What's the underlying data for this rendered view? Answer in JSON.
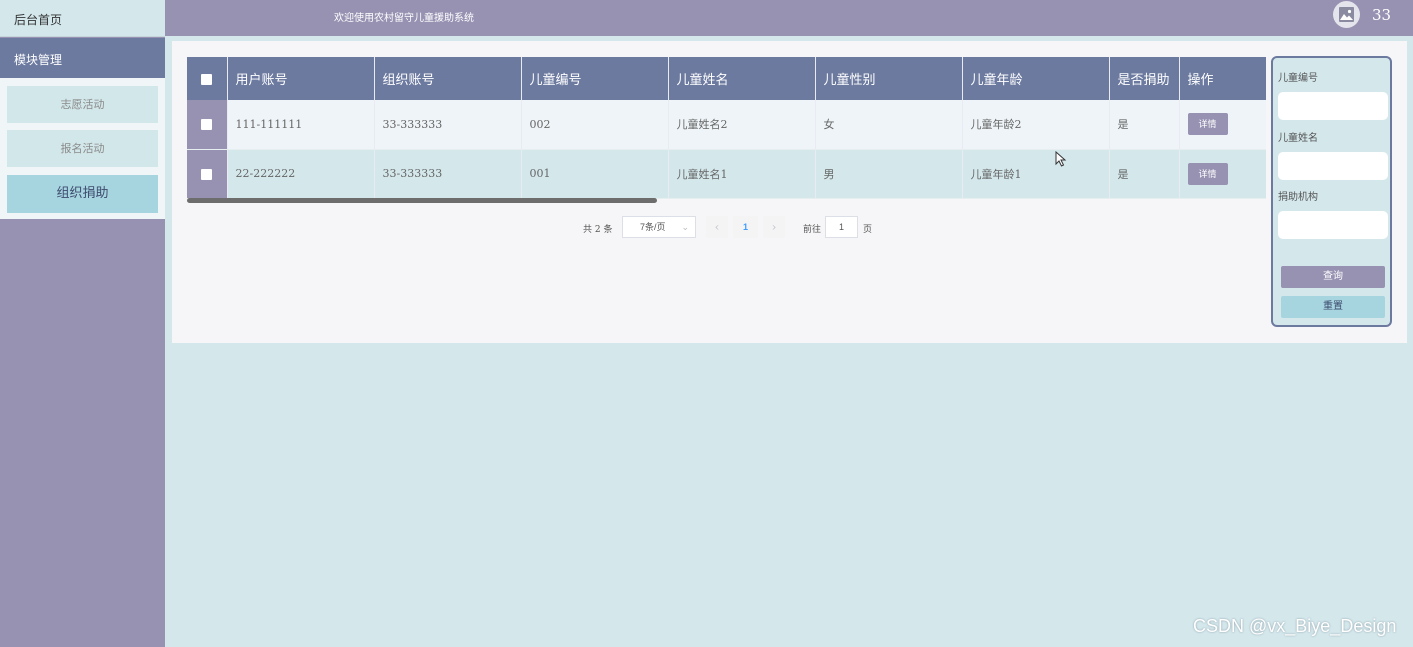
{
  "sidebar": {
    "home_label": "后台首页",
    "module_label": "模块管理",
    "items": [
      {
        "label": "志愿活动"
      },
      {
        "label": "报名活动"
      },
      {
        "label": "组织捐助"
      }
    ]
  },
  "header": {
    "welcome": "欢迎使用农村留守儿童援助系统",
    "user_number": "33"
  },
  "table": {
    "columns": [
      "用户账号",
      "组织账号",
      "儿童编号",
      "儿童姓名",
      "儿童性别",
      "儿童年龄",
      "是否捐助",
      "操作"
    ],
    "rows": [
      {
        "user_account": "111-111111",
        "org_account": "33-333333",
        "child_no": "002",
        "child_name": "儿童姓名2",
        "gender": "女",
        "age": "儿童年龄2",
        "donated": "是",
        "action": "详情"
      },
      {
        "user_account": "22-222222",
        "org_account": "33-333333",
        "child_no": "001",
        "child_name": "儿童姓名1",
        "gender": "男",
        "age": "儿童年龄1",
        "donated": "是",
        "action": "详情"
      }
    ]
  },
  "pagination": {
    "total": "共 2 条",
    "page_size": "7条/页",
    "current_page": "1",
    "goto_label": "前往",
    "goto_value": "1",
    "page_unit": "页"
  },
  "search": {
    "field1_label": "儿童编号",
    "field2_label": "儿童姓名",
    "field3_label": "捐助机构",
    "query_button": "查询",
    "reset_button": "重置"
  },
  "watermark": "CSDN @vx_Biye_Design",
  "colors": {
    "sidebar_bg": "#9791b2",
    "header_bg": "#6c7aa0",
    "content_bg": "#d4e8ec",
    "active_item": "#a6d5df"
  }
}
